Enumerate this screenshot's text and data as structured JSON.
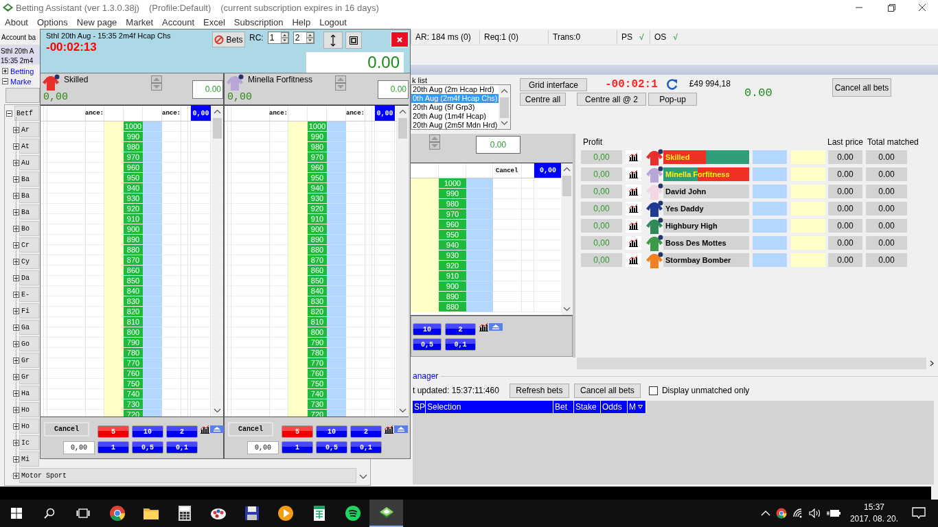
{
  "window": {
    "title": "Betting Assistant (ver 1.3.0.38j)",
    "profile": "(Profile:Default)",
    "subscription": "(current subscription expires in 16 days)"
  },
  "menu": [
    "About",
    "Options",
    "New page",
    "Market",
    "Account",
    "Excel",
    "Subscription",
    "Help",
    "Logout"
  ],
  "status_row": {
    "account": "Account ba",
    "stats": [
      "AR: 184 ms (0)",
      "Req:1 (0)",
      "Trans:0"
    ],
    "checks": [
      {
        "label": "PS",
        "tick": "√"
      },
      {
        "label": "OS",
        "tick": "√"
      }
    ]
  },
  "left_panel": {
    "market_lines": [
      "Sthl  20th A",
      "15:35 2m4"
    ],
    "links": [
      {
        "label": "Betting",
        "expanded": false
      },
      {
        "label": "Marke",
        "expanded": true
      }
    ],
    "tree": [
      {
        "label": "Betf",
        "expanded": true,
        "children": [
          {
            "label": "Ar",
            "expanded": false
          },
          {
            "label": "At",
            "expanded": false
          },
          {
            "label": "Au",
            "expanded": false
          },
          {
            "label": "Ba",
            "expanded": false
          },
          {
            "label": "Ba",
            "expanded": false
          },
          {
            "label": "Ba",
            "expanded": false
          },
          {
            "label": "Bo",
            "expanded": false
          },
          {
            "label": "Cr",
            "expanded": false
          },
          {
            "label": "Cy",
            "expanded": false
          },
          {
            "label": "Da",
            "expanded": false
          },
          {
            "label": "E-",
            "expanded": false
          },
          {
            "label": "Fi",
            "expanded": false
          },
          {
            "label": "Ga",
            "expanded": false
          },
          {
            "label": "Go",
            "expanded": false
          },
          {
            "label": "Gr",
            "expanded": false
          },
          {
            "label": "Gr",
            "expanded": false
          },
          {
            "label": "Ha",
            "expanded": false
          },
          {
            "label": "Ho",
            "expanded": false
          },
          {
            "label": "Ho",
            "expanded": false
          },
          {
            "label": "Ic",
            "expanded": false
          },
          {
            "label": "Mi",
            "expanded": false
          },
          {
            "label": "Motor Sport",
            "expanded": false
          }
        ]
      }
    ]
  },
  "popup": {
    "title": "Sthl  20th Aug - 15:35 2m4f Hcap Chs",
    "countdown": "-00:02:13",
    "bets_button": "Bets",
    "rc_label": "RC:",
    "rc_spinners": [
      "1",
      "2"
    ],
    "total": "0.00",
    "ladders": [
      {
        "runner": "Skilled",
        "color": "#e8302a",
        "profit": "0,00",
        "stake_box": "0.00",
        "headers": [
          "ance:",
          "ance:"
        ],
        "header_total": "0,00",
        "prices": [
          "1000",
          "990",
          "980",
          "970",
          "960",
          "950",
          "940",
          "930",
          "920",
          "910",
          "900",
          "890",
          "880",
          "870",
          "860",
          "850",
          "840",
          "830",
          "820",
          "810",
          "800",
          "790",
          "780",
          "770",
          "760",
          "750",
          "740",
          "730",
          "720"
        ],
        "cancel": "Cancel",
        "stake": "0,00",
        "stake_buttons": [
          {
            "label": "5",
            "selected": true
          },
          {
            "label": "10",
            "selected": false
          },
          {
            "label": "2",
            "selected": false
          },
          {
            "label": "1",
            "selected": false
          },
          {
            "label": "0,5",
            "selected": false
          },
          {
            "label": "0,1",
            "selected": false
          }
        ]
      },
      {
        "runner": "Minella Forfitness",
        "color": "#b9a6d8",
        "profit": "0,00",
        "stake_box": "0.00",
        "headers": [
          "ance:",
          "ance:"
        ],
        "header_total": "0,00",
        "prices": [
          "1000",
          "990",
          "980",
          "970",
          "960",
          "950",
          "940",
          "930",
          "920",
          "910",
          "900",
          "890",
          "880",
          "870",
          "860",
          "850",
          "840",
          "830",
          "820",
          "810",
          "800",
          "790",
          "780",
          "770",
          "760",
          "750",
          "740",
          "730",
          "720"
        ],
        "cancel": "Cancel",
        "stake": "0,00",
        "stake_buttons": [
          {
            "label": "5",
            "selected": true
          },
          {
            "label": "10",
            "selected": false
          },
          {
            "label": "2",
            "selected": false
          },
          {
            "label": "1",
            "selected": false
          },
          {
            "label": "0,5",
            "selected": false
          },
          {
            "label": "0,1",
            "selected": false
          }
        ]
      }
    ]
  },
  "market_list": {
    "label": "k list",
    "items": [
      {
        "label": "20th Aug (2m Hcap Hrd)",
        "selected": false
      },
      {
        "label": "0th Aug (2m4f Hcap Chs)",
        "selected": true
      },
      {
        "label": "20th Aug (5f Grp3)",
        "selected": false
      },
      {
        "label": "20th Aug (1m4f Hcap)",
        "selected": false
      },
      {
        "label": "20th Aug (2m5f Mdn Hrd)",
        "selected": false
      }
    ]
  },
  "toolbar": {
    "grid_button": "Grid interface",
    "centre_buttons": [
      "Centre all",
      "Centre all @ 2",
      "Pop-up"
    ],
    "countdown": "-00:02:1",
    "balance": "£49 994,18",
    "total": "0.00",
    "cancel_all": "Cancel all bets"
  },
  "main_ladder": {
    "stake_box": "0.00",
    "cancel": "Cancel",
    "header_total": "0,00",
    "prices": [
      "1000",
      "990",
      "980",
      "970",
      "960",
      "950",
      "940",
      "930",
      "920",
      "910",
      "900",
      "890",
      "880"
    ],
    "stake_buttons": [
      {
        "label": "10",
        "selected": false
      },
      {
        "label": "2",
        "selected": false
      },
      {
        "label": "0,5",
        "selected": false
      },
      {
        "label": "0,1",
        "selected": false
      }
    ]
  },
  "grid": {
    "columns": [
      "Profit",
      "Last price",
      "Total matched"
    ],
    "runners": [
      {
        "name": "Skilled",
        "color": "#e8302a",
        "kind": "back-lay",
        "profit": "0,00",
        "last_price": "0.00",
        "total_matched": "0.00"
      },
      {
        "name": "Minella Forfitness",
        "color": "#b9a6d8",
        "kind": "lay-back",
        "profit": "0,00",
        "last_price": "0.00",
        "total_matched": "0.00"
      },
      {
        "name": "David John",
        "color": "#f2d6e4",
        "kind": "plain",
        "profit": "0,00",
        "last_price": "0.00",
        "total_matched": "0.00"
      },
      {
        "name": "Yes Daddy",
        "color": "#1f3a93",
        "kind": "plain",
        "profit": "0,00",
        "last_price": "0.00",
        "total_matched": "0.00"
      },
      {
        "name": "Highbury High",
        "color": "#2e8b57",
        "kind": "plain",
        "profit": "0,00",
        "last_price": "0.00",
        "total_matched": "0.00"
      },
      {
        "name": "Boss Des Mottes",
        "color": "#3c9a4a",
        "kind": "plain",
        "profit": "0,00",
        "last_price": "0.00",
        "total_matched": "0.00"
      },
      {
        "name": "Stormbay Bomber",
        "color": "#f08020",
        "kind": "plain",
        "profit": "0,00",
        "last_price": "0.00",
        "total_matched": "0.00"
      }
    ]
  },
  "bet_manager": {
    "title": "anager",
    "updated": "t updated: 15:37:11:460",
    "buttons": [
      "Refresh bets",
      "Cancel all bets"
    ],
    "unmatched_only": {
      "label": "Display unmatched only",
      "checked": false
    },
    "columns": [
      "SP",
      "Selection",
      "Bet",
      "Stake",
      "Odds",
      "M"
    ]
  },
  "taskbar": {
    "apps": [
      {
        "kind": "chrome",
        "selected": false
      },
      {
        "kind": "folder",
        "selected": false
      },
      {
        "kind": "calculator",
        "selected": false
      },
      {
        "kind": "paint",
        "selected": false
      },
      {
        "kind": "floppy",
        "selected": false
      },
      {
        "kind": "play",
        "selected": false
      },
      {
        "kind": "spreadsheet",
        "selected": false
      },
      {
        "kind": "spotify",
        "selected": false
      },
      {
        "kind": "betting",
        "selected": true
      }
    ],
    "time": "15:37",
    "date": "2017. 08. 20."
  }
}
